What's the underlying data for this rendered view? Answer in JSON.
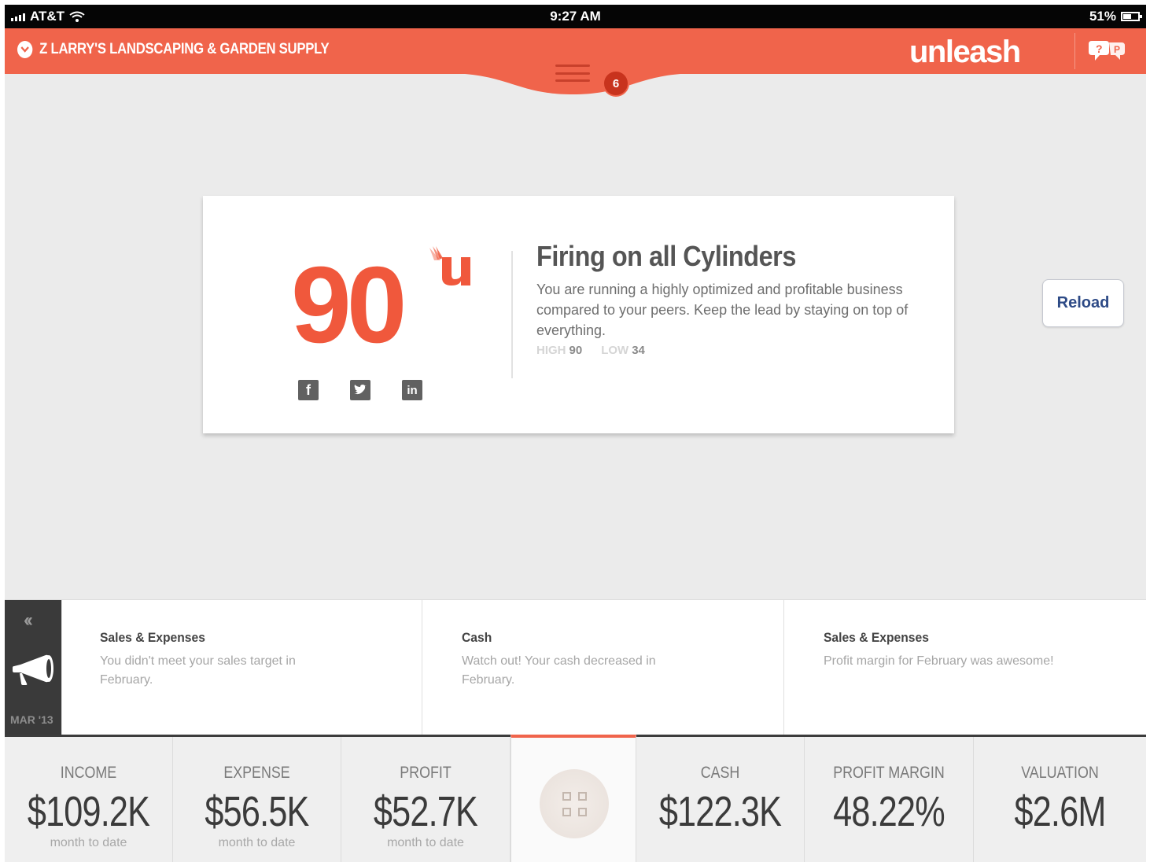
{
  "status_bar": {
    "carrier": "AT&T",
    "time": "9:27 AM",
    "battery": "51%"
  },
  "header": {
    "company_name": "Z LARRY'S LANDSCAPING & GARDEN SUPPLY",
    "brand": "unleash",
    "notification_count": "6",
    "accent_color": "#f0644b"
  },
  "score_card": {
    "score": "90",
    "title": "Firing on all Cylinders",
    "description": "You are running a highly optimized and profitable business compared to your peers. Keep the lead by staying on top of everything.",
    "high_label": "HIGH",
    "high_value": "90",
    "low_label": "LOW",
    "low_value": "34",
    "socials": [
      {
        "icon": "facebook-icon",
        "glyph": "f"
      },
      {
        "icon": "twitter-icon",
        "glyph": "t"
      },
      {
        "icon": "linkedin-icon",
        "glyph": "in"
      }
    ]
  },
  "reload_button": {
    "label": "Reload"
  },
  "insights": {
    "date": "MAR '13",
    "items": [
      {
        "title": "Sales & Expenses",
        "text": "You didn't meet your sales target in February."
      },
      {
        "title": "Cash",
        "text": "Watch out! Your cash decreased in February."
      },
      {
        "title": "Sales & Expenses",
        "text": "Profit margin for February was awesome!"
      }
    ]
  },
  "metrics": [
    {
      "label": "INCOME",
      "value": "$109.2K",
      "sub": "month to date"
    },
    {
      "label": "EXPENSE",
      "value": "$56.5K",
      "sub": "month to date"
    },
    {
      "label": "PROFIT",
      "value": "$52.7K",
      "sub": "month to date"
    },
    {
      "label": "CASH",
      "value": "$122.3K",
      "sub": ""
    },
    {
      "label": "PROFIT MARGIN",
      "value": "48.22%",
      "sub": ""
    },
    {
      "label": "VALUATION",
      "value": "$2.6M",
      "sub": ""
    }
  ]
}
